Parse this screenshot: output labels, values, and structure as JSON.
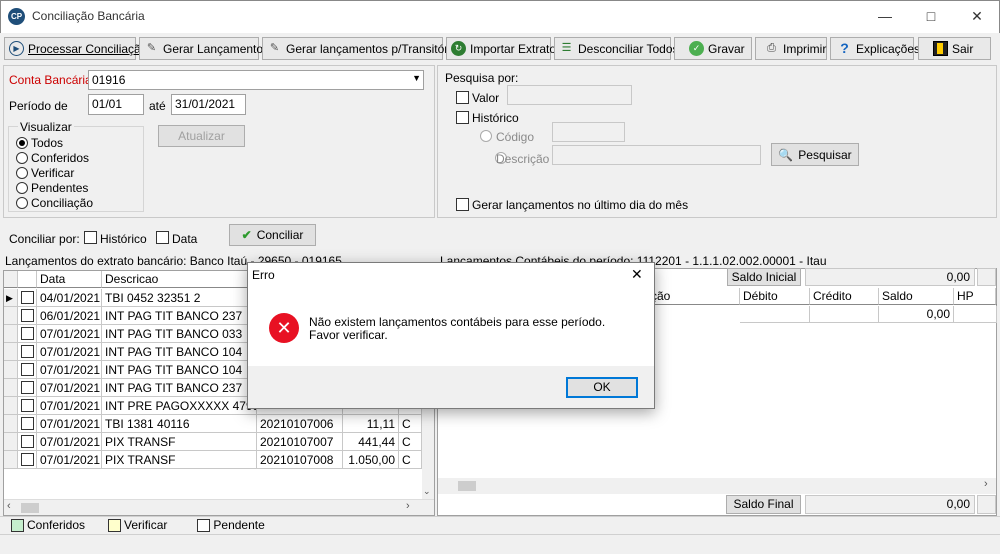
{
  "window": {
    "title": "Conciliação Bancária",
    "app_icon_text": "CP"
  },
  "toolbar": [
    {
      "label": "Processar Conciliação",
      "icon": "play-icon"
    },
    {
      "label": "Gerar Lançamentos",
      "icon": "edit-icon"
    },
    {
      "label": "Gerar lançamentos p/Transitória",
      "icon": "edit-icon"
    },
    {
      "label": "Importar Extrato",
      "icon": "import-icon"
    },
    {
      "label": "Desconciliar Todos",
      "icon": "unreconcile-icon"
    },
    {
      "label": "Gravar",
      "icon": "save-icon"
    },
    {
      "label": "Imprimir",
      "icon": "printer-icon"
    },
    {
      "label": "Explicações",
      "icon": "help-icon"
    },
    {
      "label": "Sair",
      "icon": "exit-icon"
    }
  ],
  "form": {
    "conta_label": "Conta Bancária",
    "conta_value": "01916",
    "periodo_label": "Período de",
    "periodo_de": "01/01",
    "ate_label": "até",
    "periodo_ate": "31/01/2021",
    "visualizar_label": "Visualizar",
    "visualizar_options": [
      "Todos",
      "Conferidos",
      "Verificar",
      "Pendentes",
      "Conciliação"
    ],
    "visualizar_selected": "Todos",
    "atualizar_label": "Atualizar"
  },
  "search": {
    "title": "Pesquisa por:",
    "valor_label": "Valor",
    "historico_label": "Histórico",
    "codigo_label": "Código",
    "descricao_label": "Descrição",
    "pesquisar_label": "Pesquisar",
    "gerar_ultimo_dia_label": "Gerar lançamentos no último dia do mês"
  },
  "conciliar": {
    "label": "Conciliar por:",
    "historico_label": "Histórico",
    "data_label": "Data",
    "button_label": "Conciliar"
  },
  "left_grid": {
    "caption": "Lançamentos do extrato bancário: Banco Itaú - 29650 - 019165",
    "headers": [
      "Data",
      "Descricao"
    ],
    "rows": [
      {
        "data": "04/01/2021",
        "descricao": "TBI 0452 32351 2",
        "doc": "",
        "valor": "",
        "dc": ""
      },
      {
        "data": "06/01/2021",
        "descricao": "INT  PAG TIT BANCO 237",
        "doc": "",
        "valor": "",
        "dc": ""
      },
      {
        "data": "07/01/2021",
        "descricao": "INT  PAG TIT BANCO 033",
        "doc": "",
        "valor": "",
        "dc": ""
      },
      {
        "data": "07/01/2021",
        "descricao": "INT  PAG TIT BANCO 104",
        "doc": "",
        "valor": "",
        "dc": ""
      },
      {
        "data": "07/01/2021",
        "descricao": "INT  PAG TIT BANCO 104",
        "doc": "",
        "valor": "",
        "dc": ""
      },
      {
        "data": "07/01/2021",
        "descricao": "INT  PAG TIT BANCO 237",
        "doc": "",
        "valor": "",
        "dc": ""
      },
      {
        "data": "07/01/2021",
        "descricao": "INT PRE PAGOXXXXX  4798",
        "doc": "",
        "valor": "",
        "dc": ""
      },
      {
        "data": "07/01/2021",
        "descricao": "TBI 1381 40116",
        "doc": "20210107006",
        "valor": "11,11",
        "dc": "C"
      },
      {
        "data": "07/01/2021",
        "descricao": "PIX TRANSF",
        "doc": "20210107007",
        "valor": "441,44",
        "dc": "C"
      },
      {
        "data": "07/01/2021",
        "descricao": "PIX TRANSF",
        "doc": "20210107008",
        "valor": "1.050,00",
        "dc": "C"
      }
    ]
  },
  "right_grid": {
    "caption": "Lançamentos Contábeis do período: 1112201 - 1.1.1.02.002.00001 - Itau",
    "saldo_inicial_label": "Saldo Inicial",
    "saldo_inicial_value": "0,00",
    "headers": [
      "ção",
      "Débito",
      "Crédito",
      "Saldo",
      "HP"
    ],
    "first_row_saldo": "0,00",
    "saldo_final_label": "Saldo Final",
    "saldo_final_value": "0,00"
  },
  "legend": [
    {
      "label": "Conferidos",
      "color": "#c6efce"
    },
    {
      "label": "Verificar",
      "color": "#ffffcc"
    },
    {
      "label": "Pendente",
      "color": "#ffffff"
    }
  ],
  "dialog": {
    "title": "Erro",
    "message": "Não existem lançamentos contábeis para esse período. Favor verificar.",
    "ok_label": "OK"
  },
  "colors": {
    "label_red": "#cc0000",
    "error_red": "#e81123",
    "dialog_button_border": "#0078d7"
  }
}
